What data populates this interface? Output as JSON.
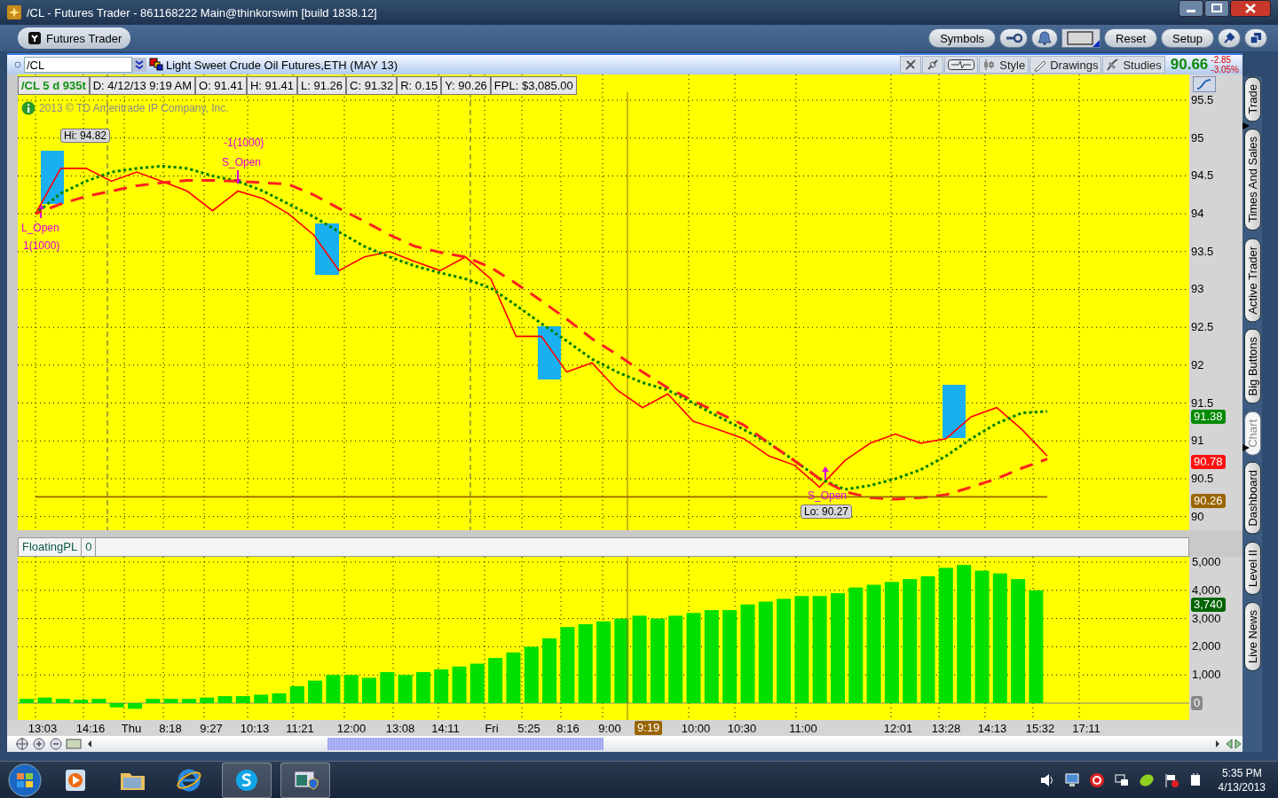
{
  "window": {
    "title": "/CL - Futures Trader - 861168222 Main@thinkorswim [build 1838.12]"
  },
  "toolbar": {
    "tab": "Futures Trader",
    "buttons": [
      {
        "kind": "text",
        "label": "Symbols"
      },
      {
        "kind": "wrench"
      },
      {
        "kind": "bell"
      },
      {
        "kind": "swatch"
      },
      {
        "kind": "text",
        "label": "Reset"
      },
      {
        "kind": "text",
        "label": "Setup"
      },
      {
        "kind": "pin"
      },
      {
        "kind": "restore"
      }
    ]
  },
  "symbol_bar": {
    "symbol": "/CL",
    "description": "Light Sweet Crude Oil Futures,ETH (MAY 13)",
    "tools": [
      "Style",
      "Drawings",
      "Studies"
    ],
    "last": "90.66",
    "change": "-2.85",
    "change_pct": "-3.05%"
  },
  "info_bar": [
    "/CL 5 d 935t",
    "D: 4/12/13 9:19 AM",
    "O: 91.41",
    "H: 91.41",
    "L: 91.26",
    "C: 91.32",
    "R: 0.15",
    "Y: 90.26",
    "FPL: $3,085.00"
  ],
  "price_chart": {
    "copyright": "2013 © TD Ameritrade IP Company, Inc.",
    "labels": [
      {
        "kind": "tag",
        "text": "Hi: 94.82"
      },
      {
        "kind": "order",
        "text": "-1(1000)"
      },
      {
        "kind": "order",
        "text": "S_Open"
      },
      {
        "kind": "order",
        "text": "L_Open"
      },
      {
        "kind": "order",
        "text": "1(1000)"
      },
      {
        "kind": "order",
        "text": "S_Open"
      },
      {
        "kind": "tag",
        "text": "Lo: 90.27"
      }
    ],
    "price_tags": [
      {
        "text": "91.38",
        "color": "#008a00"
      },
      {
        "text": "90.78",
        "color": "#ff1010"
      },
      {
        "text": "90.26",
        "color": "#9a6400"
      }
    ],
    "chart_data": {
      "type": "line",
      "ylim": [
        89.82,
        95.84
      ],
      "yticks": [
        {
          "value": 90,
          "label": "90"
        },
        {
          "value": 90.5,
          "label": "90.5"
        },
        {
          "value": 91,
          "label": "91"
        },
        {
          "value": 91.5,
          "label": "91.5"
        },
        {
          "value": 92,
          "label": "92"
        },
        {
          "value": 92.5,
          "label": "92.5"
        },
        {
          "value": 93,
          "label": "93"
        },
        {
          "value": 93.5,
          "label": "93.5"
        },
        {
          "value": 94,
          "label": "94"
        },
        {
          "value": 94.5,
          "label": "94.5"
        },
        {
          "value": 95,
          "label": "95"
        },
        {
          "value": 95.5,
          "label": "95.5"
        }
      ],
      "grid": true,
      "series": [
        {
          "color": "#ff0000",
          "line_style": "solid",
          "values": [
            94.0,
            94.6,
            94.6,
            94.43,
            94.55,
            94.43,
            94.3,
            94.04,
            94.3,
            94.2,
            94.0,
            93.72,
            93.25,
            93.43,
            93.5,
            93.37,
            93.25,
            93.43,
            93.14,
            92.38,
            92.38,
            91.91,
            92.03,
            91.67,
            91.44,
            91.62,
            91.26,
            91.15,
            91.03,
            90.8,
            90.68,
            90.39,
            90.74,
            90.97,
            91.09,
            90.97,
            91.03,
            91.32,
            91.44,
            91.15,
            90.8
          ]
        },
        {
          "color": "#008000",
          "line_style": "dotted",
          "values": [
            94.0,
            94.27,
            94.43,
            94.55,
            94.6,
            94.63,
            94.6,
            94.5,
            94.43,
            94.3,
            94.13,
            93.96,
            93.76,
            93.57,
            93.43,
            93.31,
            93.22,
            93.14,
            93.02,
            92.79,
            92.55,
            92.32,
            92.08,
            91.91,
            91.77,
            91.67,
            91.5,
            91.32,
            91.15,
            90.97,
            90.74,
            90.5,
            90.36,
            90.41,
            90.5,
            90.62,
            90.8,
            91.03,
            91.23,
            91.37,
            91.39
          ]
        },
        {
          "color": "#ff2020",
          "line_style": "dashed",
          "values": [
            94.0,
            94.13,
            94.23,
            94.3,
            94.37,
            94.41,
            94.44,
            94.44,
            94.43,
            94.41,
            94.39,
            94.25,
            94.07,
            93.9,
            93.72,
            93.57,
            93.49,
            93.43,
            93.29,
            93.08,
            92.85,
            92.61,
            92.35,
            92.14,
            91.91,
            91.7,
            91.53,
            91.37,
            91.21,
            90.97,
            90.74,
            90.5,
            90.33,
            90.25,
            90.23,
            90.25,
            90.29,
            90.39,
            90.5,
            90.64,
            90.76
          ]
        },
        {
          "color": "#9a6400",
          "line_style": "solid",
          "values": [
            90.26,
            90.26,
            90.26,
            90.26,
            90.26,
            90.26,
            90.26,
            90.26,
            90.26,
            90.26,
            90.26,
            90.26,
            90.26,
            90.26,
            90.26,
            90.26,
            90.26,
            90.26,
            90.26,
            90.26,
            90.26,
            90.26,
            90.26,
            90.26,
            90.26,
            90.26,
            90.26,
            90.26,
            90.26,
            90.26,
            90.26,
            90.26,
            90.26,
            90.26,
            90.26,
            90.26,
            90.26,
            90.26,
            90.26,
            90.26,
            90.26
          ]
        }
      ]
    }
  },
  "time_axis": [
    "13:03",
    "14:16",
    "Thu",
    "8:18",
    "9:27",
    "10:13",
    "11:21",
    "12:00",
    "13:08",
    "14:11",
    "Fri",
    "5:25",
    "8:16",
    "9:00",
    "10:00",
    "10:30",
    "11:00",
    "12:01",
    "13:28",
    "14:13",
    "15:32",
    "17:11"
  ],
  "cursor": {
    "label": "9:19"
  },
  "pl_chart": {
    "title": "FloatingPL",
    "value": "0",
    "tags": [
      {
        "text": "3,740",
        "color": "#006400"
      },
      {
        "text": "0",
        "color": "#888888"
      }
    ],
    "chart_data": {
      "type": "bar",
      "ylim": [
        -597,
        5189
      ],
      "grid": true,
      "yticks": [
        {
          "value": 1000,
          "label": "1,000"
        },
        {
          "value": 2000,
          "label": "2,000"
        },
        {
          "value": 3000,
          "label": "3,000"
        },
        {
          "value": 4000,
          "label": "4,000"
        },
        {
          "value": 5000,
          "label": "5,000"
        }
      ],
      "series": [
        {
          "color": "#00e000",
          "values": [
            150,
            200,
            150,
            120,
            150,
            -150,
            -200,
            150,
            150,
            150,
            200,
            250,
            250,
            300,
            350,
            600,
            800,
            1000,
            1000,
            900,
            1100,
            1000,
            1100,
            1200,
            1300,
            1400,
            1600,
            1800,
            2000,
            2300,
            2700,
            2800,
            2900,
            3000,
            3100,
            3000,
            3100,
            3200,
            3300,
            3300,
            3500,
            3600,
            3700,
            3800,
            3800,
            3900,
            4100,
            4200,
            4300,
            4400,
            4500,
            4800,
            4900,
            4700,
            4600,
            4400,
            4000,
            null,
            null,
            null,
            null,
            null,
            null,
            null,
            null
          ]
        }
      ]
    }
  },
  "side_tabs": [
    {
      "label": "Trade",
      "selected": false
    },
    {
      "label": "Times And Sales",
      "selected": false
    },
    {
      "label": "Active Trader",
      "selected": false
    },
    {
      "label": "Big Buttons",
      "selected": false
    },
    {
      "label": "Chart",
      "selected": true
    },
    {
      "label": "Dashboard",
      "selected": false
    },
    {
      "label": "Level II",
      "selected": false
    },
    {
      "label": "Live News",
      "selected": false
    }
  ],
  "taskbar": {
    "time": "5:35 PM",
    "date": "4/13/2013"
  }
}
